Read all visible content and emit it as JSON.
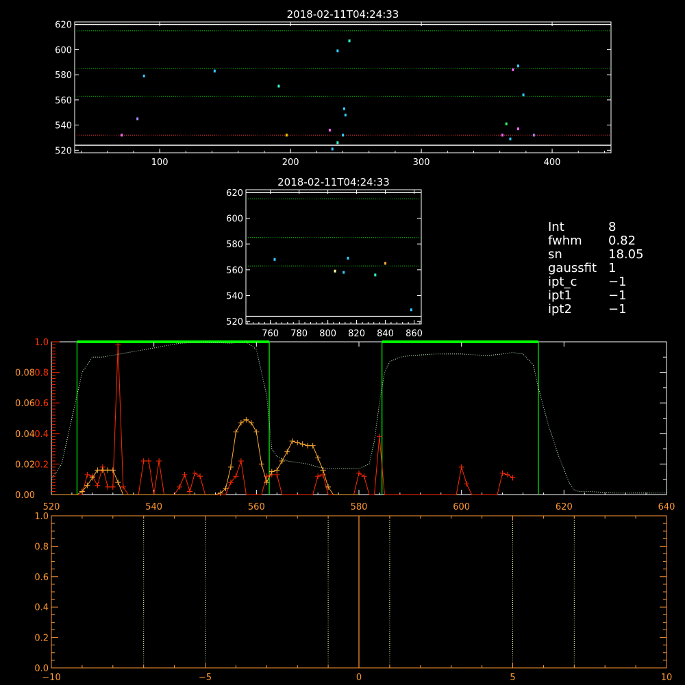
{
  "chart_data": [
    {
      "type": "scatter",
      "title": "2018-02-11T04:24:33",
      "xlim": [
        35,
        445
      ],
      "ylim": [
        518,
        622
      ],
      "xticks": [
        100,
        200,
        300,
        400
      ],
      "yticks": [
        520,
        540,
        560,
        580,
        600,
        620
      ],
      "hlines": [
        {
          "y": 620,
          "color": "#ffffff",
          "style": "solid"
        },
        {
          "y": 615,
          "color": "#00dd00",
          "style": "dotted"
        },
        {
          "y": 585,
          "color": "#00dd00",
          "style": "dotted"
        },
        {
          "y": 563,
          "color": "#00dd00",
          "style": "dotted"
        },
        {
          "y": 532,
          "color": "#ff3333",
          "style": "dotted"
        },
        {
          "y": 524,
          "color": "#ffffff",
          "style": "solid"
        }
      ],
      "points": [
        {
          "x": 71,
          "y": 532,
          "color": "#ff66ff"
        },
        {
          "x": 83,
          "y": 545,
          "color": "#aa88ff"
        },
        {
          "x": 88,
          "y": 579,
          "color": "#33ccff"
        },
        {
          "x": 142,
          "y": 583,
          "color": "#33ccff"
        },
        {
          "x": 191,
          "y": 571,
          "color": "#33ffcc"
        },
        {
          "x": 197,
          "y": 532,
          "color": "#ffcc00"
        },
        {
          "x": 230,
          "y": 536,
          "color": "#ff66ff"
        },
        {
          "x": 232,
          "y": 521,
          "color": "#33ccff"
        },
        {
          "x": 236,
          "y": 526,
          "color": "#33ffcc"
        },
        {
          "x": 236,
          "y": 599,
          "color": "#33ccff"
        },
        {
          "x": 240,
          "y": 532,
          "color": "#33ccff"
        },
        {
          "x": 241,
          "y": 553,
          "color": "#33ccff"
        },
        {
          "x": 242,
          "y": 548,
          "color": "#33ccff"
        },
        {
          "x": 245,
          "y": 607,
          "color": "#33ffcc"
        },
        {
          "x": 362,
          "y": 532,
          "color": "#ff66ff"
        },
        {
          "x": 365,
          "y": 541,
          "color": "#33ff66"
        },
        {
          "x": 368,
          "y": 529,
          "color": "#33ccff"
        },
        {
          "x": 370,
          "y": 584,
          "color": "#ff66ff"
        },
        {
          "x": 374,
          "y": 537,
          "color": "#ff66ff"
        },
        {
          "x": 374,
          "y": 587,
          "color": "#33ccff"
        },
        {
          "x": 378,
          "y": 564,
          "color": "#33ccff"
        },
        {
          "x": 386,
          "y": 532,
          "color": "#aa88ff"
        }
      ]
    },
    {
      "type": "scatter",
      "title": "2018-02-11T04:24:33",
      "xlim": [
        743,
        865
      ],
      "ylim": [
        518,
        622
      ],
      "xticks": [
        760,
        780,
        800,
        820,
        840,
        860
      ],
      "yticks": [
        520,
        540,
        560,
        580,
        600,
        620
      ],
      "hlines": [
        {
          "y": 620,
          "color": "#ffffff",
          "style": "solid"
        },
        {
          "y": 615,
          "color": "#00dd00",
          "style": "dotted"
        },
        {
          "y": 585,
          "color": "#00dd00",
          "style": "dotted"
        },
        {
          "y": 563,
          "color": "#00dd00",
          "style": "dotted"
        },
        {
          "y": 524,
          "color": "#ffffff",
          "style": "solid"
        }
      ],
      "points": [
        {
          "x": 763,
          "y": 568,
          "color": "#33ccff"
        },
        {
          "x": 805,
          "y": 559,
          "color": "#ffffaa"
        },
        {
          "x": 811,
          "y": 558,
          "color": "#33ccff"
        },
        {
          "x": 814,
          "y": 569,
          "color": "#33ccff"
        },
        {
          "x": 833,
          "y": 556,
          "color": "#33ffcc"
        },
        {
          "x": 840,
          "y": 565,
          "color": "#ffaa33"
        },
        {
          "x": 858,
          "y": 529,
          "color": "#33ccff"
        }
      ]
    },
    {
      "type": "line",
      "xlim": [
        520,
        640
      ],
      "ylim": [
        0,
        1.0
      ],
      "ylim_secondary": [
        0,
        0.1
      ],
      "xticks": [
        520,
        540,
        560,
        580,
        600,
        620,
        640
      ],
      "yticks_left_primary": [
        0.2,
        0.4,
        0.6,
        0.8,
        1.0
      ],
      "yticks_left_secondary": [
        0.0,
        0.02,
        0.04,
        0.06,
        0.08
      ],
      "bands": [
        {
          "x0": 525,
          "x1": 562.5
        },
        {
          "x0": 584.5,
          "x1": 615
        }
      ],
      "series": [
        {
          "color": "#ff2a00",
          "marker": "plus",
          "x": [
            521,
            522,
            523,
            524,
            525,
            526,
            527,
            528,
            529,
            530,
            531,
            532,
            533,
            534,
            535,
            536,
            537,
            538,
            539,
            540,
            541,
            542,
            543,
            544,
            545,
            546,
            547,
            548,
            549,
            550,
            551,
            552,
            553,
            554,
            555,
            556,
            557,
            558,
            559,
            560,
            561,
            562,
            563,
            564,
            565,
            566,
            567,
            568,
            569,
            570,
            571,
            572,
            573,
            574,
            575,
            576,
            577,
            578,
            579,
            580,
            581,
            582,
            583,
            584,
            585,
            586,
            587,
            588,
            589,
            590,
            591,
            592,
            593,
            594,
            595,
            596,
            597,
            598,
            599,
            600,
            601,
            602,
            603,
            604,
            605,
            606,
            607,
            608,
            609,
            610
          ],
          "y": [
            0,
            0,
            0,
            0,
            0,
            0,
            0.13,
            0.12,
            0.06,
            0.18,
            0.05,
            0.05,
            0.98,
            0.05,
            0,
            0,
            0,
            0.22,
            0.22,
            0,
            0.22,
            0,
            0,
            0,
            0.05,
            0.13,
            0.02,
            0.14,
            0.12,
            0,
            0,
            0,
            0,
            0,
            0.08,
            0.12,
            0.22,
            0,
            0,
            0,
            0,
            0.12,
            0.13,
            0.13,
            0,
            0,
            0,
            0,
            0,
            0,
            0,
            0.12,
            0.13,
            0,
            0,
            0,
            0,
            0,
            0,
            0.14,
            0.12,
            0,
            0,
            0.38,
            0,
            0,
            0,
            0,
            0,
            0,
            0,
            0,
            0,
            0,
            0,
            0,
            0,
            0,
            0,
            0.18,
            0.07,
            0,
            0,
            0,
            0,
            0,
            0,
            0.14,
            0.13,
            0.11
          ]
        },
        {
          "color": "#ffaa33",
          "marker": "plus",
          "x": [
            520,
            521,
            522,
            523,
            524,
            525,
            526,
            527,
            528,
            529,
            530,
            531,
            532,
            533,
            534,
            535,
            536,
            537,
            538,
            539,
            540,
            541,
            542,
            543,
            544,
            545,
            546,
            547,
            548,
            549,
            550,
            551,
            552,
            553,
            554,
            555,
            556,
            557,
            558,
            559,
            560,
            561,
            562,
            563,
            564,
            565,
            566,
            567,
            568,
            569,
            570,
            571,
            572,
            573,
            574,
            575,
            576,
            577,
            578,
            579,
            580
          ],
          "y": [
            0,
            0,
            0,
            0,
            0,
            0,
            0.02,
            0.06,
            0.11,
            0.16,
            0.16,
            0.16,
            0.16,
            0.08,
            0,
            0,
            0,
            0,
            0,
            0,
            0,
            0,
            0,
            0,
            0,
            0,
            0,
            0,
            0,
            0,
            0,
            0,
            0,
            0.01,
            0.04,
            0.18,
            0.41,
            0.47,
            0.49,
            0.47,
            0.41,
            0.2,
            0.08,
            0.15,
            0.16,
            0.22,
            0.28,
            0.35,
            0.34,
            0.33,
            0.32,
            0.32,
            0.24,
            0.16,
            0.05,
            0,
            0,
            0,
            0,
            0,
            0
          ]
        },
        {
          "color": "#ccffcc",
          "style": "dotted",
          "x": [
            520,
            522,
            524,
            526,
            528,
            530,
            535,
            540,
            545,
            550,
            555,
            558,
            560,
            562,
            563,
            564,
            566,
            568,
            570,
            572,
            574,
            576,
            578,
            580,
            582,
            583,
            584,
            585,
            586,
            588,
            590,
            595,
            600,
            605,
            608,
            610,
            612,
            614,
            615,
            617,
            619,
            621,
            622,
            623,
            625,
            630,
            635,
            640
          ],
          "y": [
            0.01,
            0.02,
            0.05,
            0.08,
            0.09,
            0.09,
            0.093,
            0.096,
            0.099,
            0.1,
            0.099,
            0.1,
            0.095,
            0.065,
            0.03,
            0.025,
            0.022,
            0.021,
            0.02,
            0.018,
            0.017,
            0.017,
            0.017,
            0.017,
            0.02,
            0.035,
            0.06,
            0.08,
            0.087,
            0.09,
            0.091,
            0.092,
            0.092,
            0.091,
            0.092,
            0.093,
            0.092,
            0.085,
            0.07,
            0.045,
            0.025,
            0.008,
            0.003,
            0.002,
            0.002,
            0.001,
            0.001,
            0.001
          ]
        }
      ]
    },
    {
      "type": "line",
      "xlim": [
        -10,
        10
      ],
      "ylim": [
        0,
        1.0
      ],
      "xticks": [
        -10,
        -5,
        0,
        5,
        10
      ],
      "yticks": [
        0.0,
        0.2,
        0.4,
        0.6,
        0.8,
        1.0
      ],
      "vlines_dotted": [
        -7,
        -5,
        -1,
        1,
        5,
        7
      ],
      "vline_solid": 0
    }
  ],
  "info": [
    {
      "key": "Int",
      "value": "8"
    },
    {
      "key": "fwhm",
      "value": "0.82"
    },
    {
      "key": "sn",
      "value": "18.05"
    },
    {
      "key": "gaussfit",
      "value": "1"
    },
    {
      "key": "ipt_c",
      "value": "−1"
    },
    {
      "key": "ipt1",
      "value": "−1"
    },
    {
      "key": "ipt2",
      "value": "−1"
    }
  ]
}
